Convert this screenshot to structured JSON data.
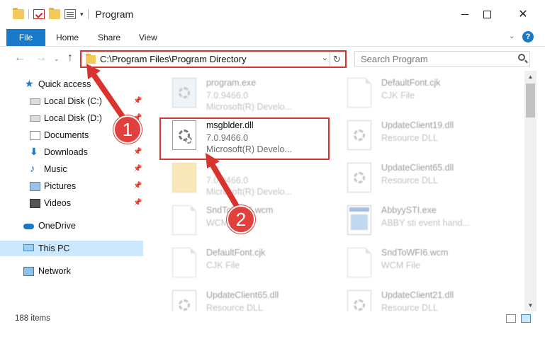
{
  "titlebar": {
    "title": "Program",
    "qa_dropdown": "▾",
    "minimize": "—",
    "maximize": "□",
    "close": "✕"
  },
  "ribbon": {
    "tabs": [
      "File",
      "Home",
      "Share",
      "View"
    ],
    "help": "?"
  },
  "navbar": {
    "back": "←",
    "forward": "→",
    "recent": "⌄",
    "up": "↑",
    "address": "C:\\Program Files\\Program Directory",
    "address_dropdown": "⌄",
    "refresh": "↻",
    "search_placeholder": "Search Program"
  },
  "sidebar": {
    "items": [
      {
        "label": "Quick access",
        "icon": "star-icon"
      },
      {
        "label": "Local Disk (C:)",
        "icon": "disk-icon",
        "pinned": true
      },
      {
        "label": "Local Disk (D:)",
        "icon": "disk-icon",
        "pinned": true
      },
      {
        "label": "Documents",
        "icon": "documents-icon",
        "pinned": true
      },
      {
        "label": "Downloads",
        "icon": "downloads-icon",
        "pinned": true
      },
      {
        "label": "Music",
        "icon": "music-icon",
        "pinned": true
      },
      {
        "label": "Pictures",
        "icon": "pictures-icon",
        "pinned": true
      },
      {
        "label": "Videos",
        "icon": "videos-icon",
        "pinned": true
      },
      {
        "label": "OneDrive",
        "icon": "onedrive-icon"
      },
      {
        "label": "This PC",
        "icon": "pc-icon",
        "selected": true
      },
      {
        "label": "Network",
        "icon": "network-icon"
      }
    ]
  },
  "files": {
    "left": [
      {
        "name": "program.exe",
        "line2": "7.0.9466.0",
        "line3": "Microsoft(R) Develo...",
        "icon": "exe-icon",
        "faded": true
      },
      {
        "name": "msgblder.dll",
        "line2": "7.0.9466.0",
        "line3": "Microsoft(R) Develo...",
        "icon": "dll-icon",
        "highlighted": true
      },
      {
        "name": "",
        "line2": "7.0.9466.0",
        "line3": "Microsoft(R) Develo...",
        "icon": "folder-file-icon",
        "faded": true
      },
      {
        "name": "SndToWFI6.wcm",
        "line2": "WCM File",
        "line3": "",
        "icon": "document-icon",
        "faded": true
      },
      {
        "name": "DefaultFont.cjk",
        "line2": "CJK File",
        "line3": "",
        "icon": "document-icon",
        "faded": true
      },
      {
        "name": "UpdateClient65.dll",
        "line2": "Resource DLL",
        "line3": "",
        "icon": "dll-icon",
        "faded": true
      }
    ],
    "right": [
      {
        "name": "DefaultFont.cjk",
        "line2": "CJK File",
        "line3": "",
        "icon": "document-icon",
        "faded": true
      },
      {
        "name": "UpdateClient19.dll",
        "line2": "Resource DLL",
        "line3": "",
        "icon": "dll-icon",
        "faded": true
      },
      {
        "name": "UpdateClient65.dll",
        "line2": "Resource DLL",
        "line3": "",
        "icon": "dll-icon",
        "faded": true
      },
      {
        "name": "AbbyySTI.exe",
        "line2": "ABBY sti event hand...",
        "line3": "",
        "icon": "window-exe-icon",
        "faded": true
      },
      {
        "name": "SndToWFI6.wcm",
        "line2": "WCM File",
        "line3": "",
        "icon": "document-icon",
        "faded": true
      },
      {
        "name": "UpdateClient21.dll",
        "line2": "Resource DLL",
        "line3": "",
        "icon": "dll-icon",
        "faded": true
      }
    ]
  },
  "status": {
    "items_count": "188 items"
  },
  "annotations": {
    "badge1": "1",
    "badge2": "2",
    "color": "#d9332f"
  },
  "colors": {
    "accent": "#1979ca",
    "highlight": "#d9332f",
    "selection": "#cce8ff"
  }
}
